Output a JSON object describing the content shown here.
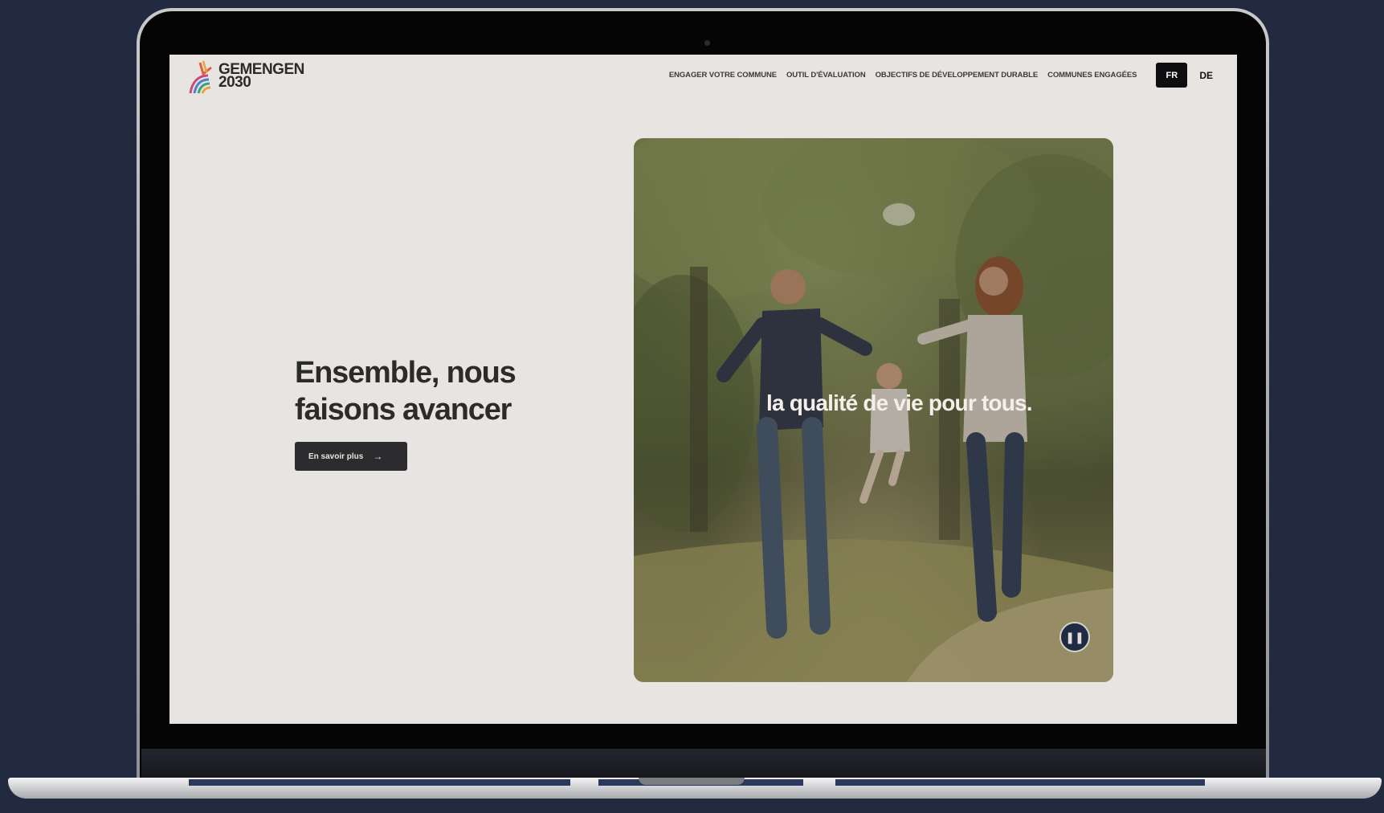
{
  "brand": {
    "name_line1": "GEMENGEN",
    "name_line2": "2030"
  },
  "nav": {
    "items": [
      {
        "label": "ENGAGER VOTRE COMMUNE"
      },
      {
        "label": "OUTIL D'ÉVALUATION"
      },
      {
        "label": "OBJECTIFS DE DÉVELOPPEMENT DURABLE"
      },
      {
        "label": "COMMUNES ENGAGÉES"
      }
    ],
    "languages": {
      "active": "FR",
      "other": "DE"
    }
  },
  "hero": {
    "headline_line1": "Ensemble, nous",
    "headline_line2": "faisons avancer",
    "cta_label": "En savoir plus",
    "cta_icon": "arrow-right-icon",
    "image_caption": "la qualité de vie pour tous.",
    "media_control_icon": "pause-icon"
  },
  "colors": {
    "page_background": "#212a3f",
    "site_background": "#e8e4e1",
    "text_dark": "#2b2b2b",
    "button_dark": "#2c2c2e",
    "accent_navy": "#1f2a44"
  }
}
